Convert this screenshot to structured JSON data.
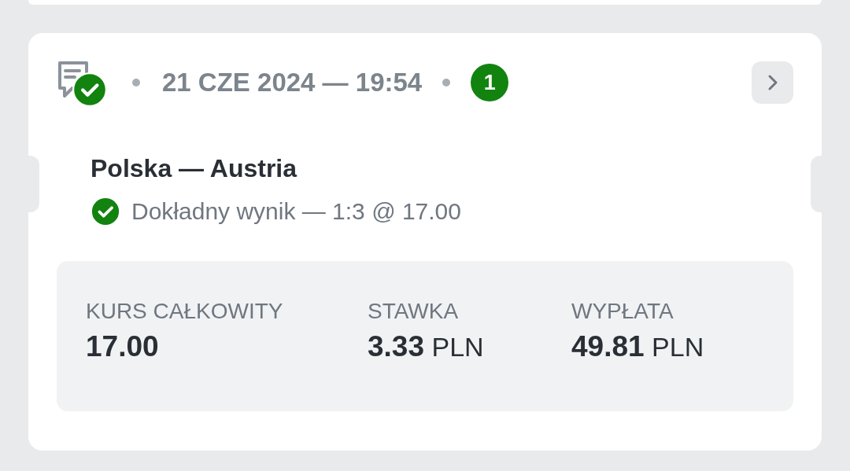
{
  "ticket": {
    "won": true,
    "date": "21 CZE 2024 — 19:54",
    "count": "1",
    "selections": [
      {
        "event": "Polska — Austria",
        "won": true,
        "pick": "Dokładny wynik — 1:3 @ 17.00"
      }
    ],
    "summary": [
      {
        "label": "KURS CAŁKOWITY",
        "value": "17.00"
      },
      {
        "label": "STAWKA",
        "value": "3.33",
        "currency": "PLN"
      },
      {
        "label": "WYPŁATA",
        "value": "49.81",
        "currency": "PLN"
      }
    ]
  }
}
